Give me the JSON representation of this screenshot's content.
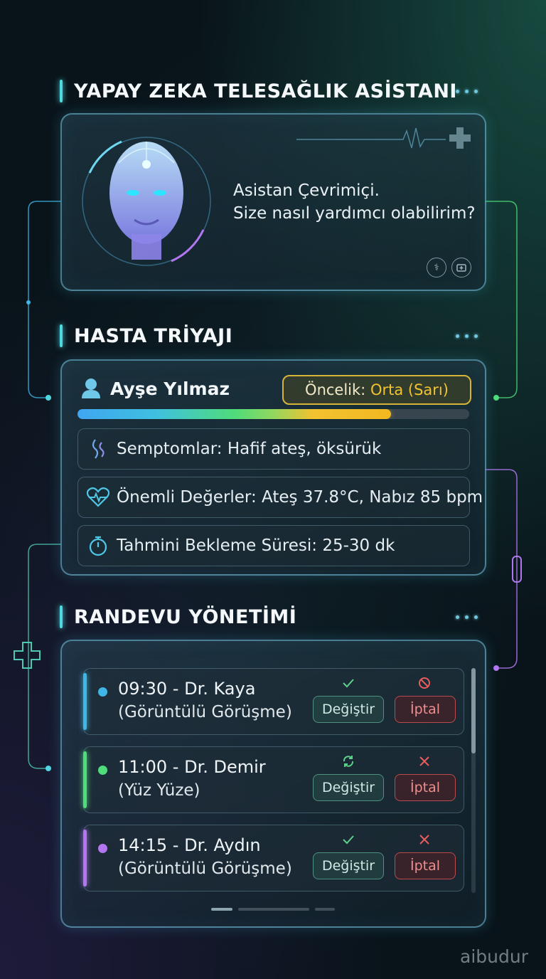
{
  "assistant": {
    "section_title": "YAPAY ZEKA TELESAĞLIK ASİSTANI",
    "status_line1": "Asistan Çevrimiçi.",
    "status_line2": "Size nasıl yardımcı olabilirim?"
  },
  "triage": {
    "section_title": "HASTA TRİYAJI",
    "patient_name": "Ayşe Yılmaz",
    "priority_label": "Öncelik: ",
    "priority_value": "Orta (Sarı)",
    "priority_level_fraction": 0.8,
    "symptoms": "Semptomlar: Hafif ateş, öksürük",
    "vitals": "Önemli Değerler: Ateş 37.8°C, Nabız 85 bpm",
    "wait_time": "Tahmini Bekleme Süresi: 25-30 dk"
  },
  "appointments": {
    "section_title": "RANDEVU YÖNETİMİ",
    "items": [
      {
        "line1": "09:30 - Dr. Kaya",
        "line2": "(Görüntülü Görüşme)",
        "color": "#3fb6e6",
        "change_label": "Değiştir",
        "cancel_label": "İptal",
        "change_icon": "check-icon",
        "cancel_icon": "prohibited-icon"
      },
      {
        "line1": "11:00 - Dr. Demir",
        "line2": "(Yüz Yüze)",
        "color": "#4fdc7a",
        "change_label": "Değiştir",
        "cancel_label": "İptal",
        "change_icon": "refresh-icon",
        "cancel_icon": "x-icon"
      },
      {
        "line1": "14:15 - Dr. Aydın",
        "line2": "(Görüntülü Görüşme)",
        "color": "#b277f0",
        "change_label": "Değiştir",
        "cancel_label": "İptal",
        "change_icon": "check-icon",
        "cancel_icon": "x-icon"
      }
    ]
  },
  "watermark": "aibudur",
  "colors": {
    "accent_cyan": "#4fd8e0",
    "priority_yellow": "#f2c230",
    "change_green": "#6ec8a8",
    "cancel_red": "#e85c5c"
  }
}
